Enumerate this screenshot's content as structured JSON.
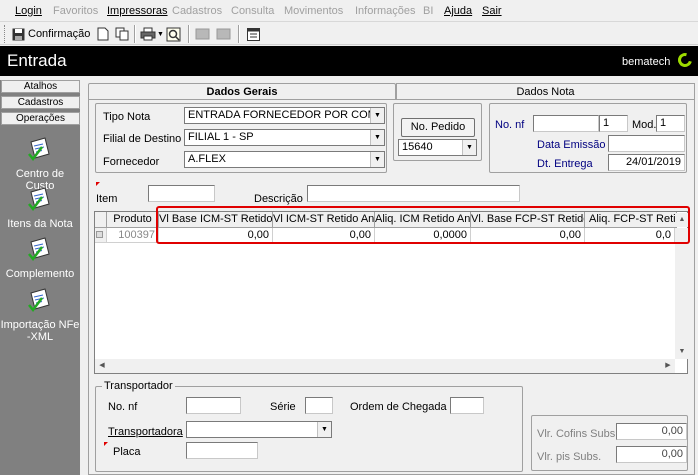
{
  "menu": [
    "Login",
    "Favoritos",
    "Impressoras",
    "Cadastros",
    "Consulta",
    "Movimentos",
    "Informações",
    "BI",
    "Ajuda",
    "Sair"
  ],
  "toolbar": {
    "confirm_label": "Confirmação"
  },
  "header": {
    "title": "Entrada",
    "brand": "bematech"
  },
  "sidebar": {
    "tabs": [
      "Atalhos",
      "Cadastros",
      "Operações"
    ],
    "items": [
      "Centro de Custo",
      "Itens da Nota",
      "Complemento",
      "Importação NFe -XML"
    ]
  },
  "tabs": {
    "active": "Dados Gerais",
    "inactive": "Dados Nota"
  },
  "form": {
    "tipo_nota_label": "Tipo Nota",
    "tipo_nota_value": "ENTRADA FORNECEDOR POR COMPRAS",
    "filial_label": "Filial de Destino",
    "filial_value": "FILIAL 1 - SP",
    "fornecedor_label": "Fornecedor",
    "fornecedor_value": "A.FLEX",
    "pedido_button": "No. Pedido",
    "pedido_value": "15640",
    "nonf_label": "No. nf",
    "nonf_serie": "1",
    "mod_label": "Mod.",
    "mod_value": "1",
    "emissao_label": "Data Emissão",
    "emissao_value": "",
    "entrega_label": "Dt. Entrega",
    "entrega_value": "24/01/2019",
    "item_label": "Item",
    "descricao_label": "Descrição"
  },
  "grid": {
    "columns": [
      "Produto",
      "Vl Base ICM-ST Retido",
      "Vl ICM-ST Retido Ant.",
      "Aliq. ICM Retido Ant.",
      "Vl. Base FCP-ST Retido",
      "Aliq. FCP-ST Retido A"
    ],
    "rows": [
      [
        "100397",
        "0,00",
        "0,00",
        "0,0000",
        "0,00",
        "0,0"
      ]
    ]
  },
  "transport": {
    "group_label": "Transportador",
    "nonf_label": "No. nf",
    "serie_label": "Série",
    "ordem_label": "Ordem de Chegada",
    "transportadora_label": "Transportadora",
    "placa_label": "Placa"
  },
  "totals": {
    "cofins_label": "Vlr. Cofins Subs.",
    "cofins_value": "0,00",
    "pis_label": "Vlr. pis Subs.",
    "pis_value": "0,00"
  }
}
